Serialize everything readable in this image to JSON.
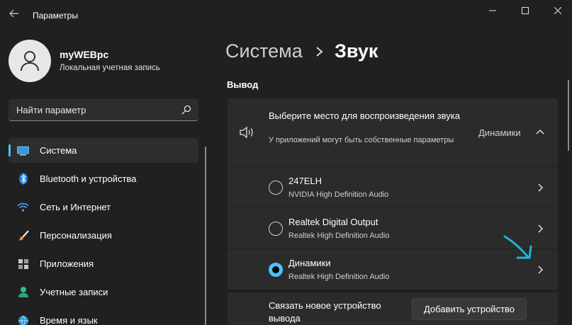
{
  "window": {
    "title": "Параметры"
  },
  "user": {
    "name": "myWEBpc",
    "account_type": "Локальная учетная запись"
  },
  "search": {
    "placeholder": "Найти параметр"
  },
  "nav": {
    "items": [
      {
        "label": "Система",
        "icon": "display-icon",
        "active": true
      },
      {
        "label": "Bluetooth и устройства",
        "icon": "bluetooth-icon",
        "active": false
      },
      {
        "label": "Сеть и Интернет",
        "icon": "wifi-icon",
        "active": false
      },
      {
        "label": "Персонализация",
        "icon": "brush-icon",
        "active": false
      },
      {
        "label": "Приложения",
        "icon": "apps-icon",
        "active": false
      },
      {
        "label": "Учетные записи",
        "icon": "person-icon",
        "active": false
      },
      {
        "label": "Время и язык",
        "icon": "globe-icon",
        "active": false
      }
    ]
  },
  "breadcrumb": {
    "parent": "Система",
    "current": "Звук"
  },
  "output": {
    "section_title": "Вывод",
    "header": {
      "title": "Выберите место для воспроизведения звука",
      "subtitle": "У приложений могут быть собственные параметры",
      "value": "Динамики"
    },
    "devices": [
      {
        "name": "247ELH",
        "driver": "NVIDIA High Definition Audio",
        "selected": false
      },
      {
        "name": "Realtek Digital Output",
        "driver": "Realtek High Definition Audio",
        "selected": false
      },
      {
        "name": "Динамики",
        "driver": "Realtek High Definition Audio",
        "selected": true
      }
    ],
    "pair": {
      "text": "Связать новое устройство вывода",
      "button_label": "Добавить устройство"
    }
  },
  "colors": {
    "background": "#202020",
    "card": "#2b2b2b",
    "accent": "#4cc2ff",
    "annotation": "#1fb5d6"
  }
}
